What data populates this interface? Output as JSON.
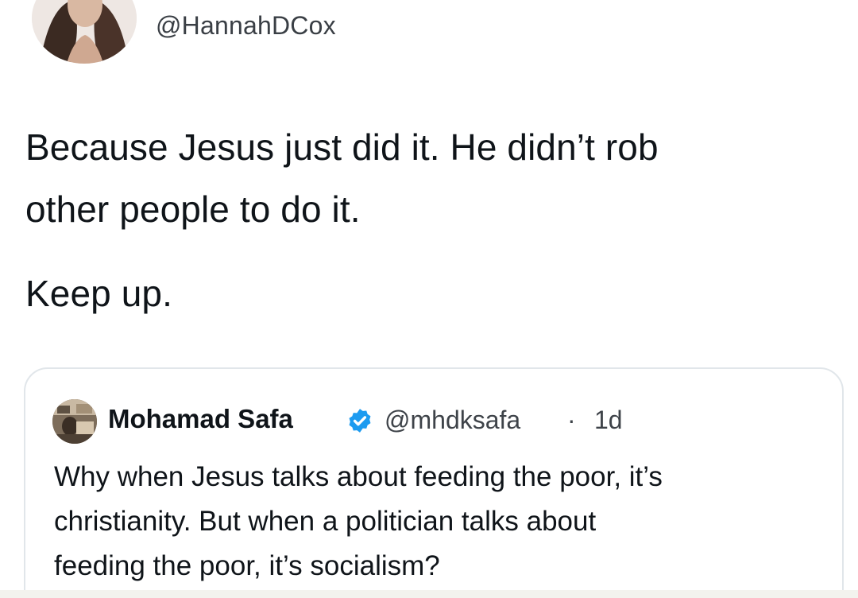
{
  "tweet": {
    "handle": "@HannahDCox",
    "body_lines": [
      "Because Jesus just did it. He didn’t rob",
      "other people to do it.",
      "Keep up."
    ]
  },
  "quote": {
    "display_name": "Mohamad Safa",
    "handle": "@mhdksafa",
    "separator": "·",
    "time": "1d",
    "body_lines": [
      "Why when Jesus talks about feeding the poor, it’s",
      "christianity. But when a politician talks about",
      "feeding the poor, it’s socialism?"
    ],
    "verified": true
  },
  "colors": {
    "text": "#0f1419",
    "secondary_text": "#3e4349",
    "card_border": "#e1e6ea",
    "verified_blue": "#1d9bf0"
  },
  "icons": {
    "author_avatar": "profile-photo",
    "quote_avatar": "profile-photo",
    "verified": "verified-badge-icon"
  }
}
